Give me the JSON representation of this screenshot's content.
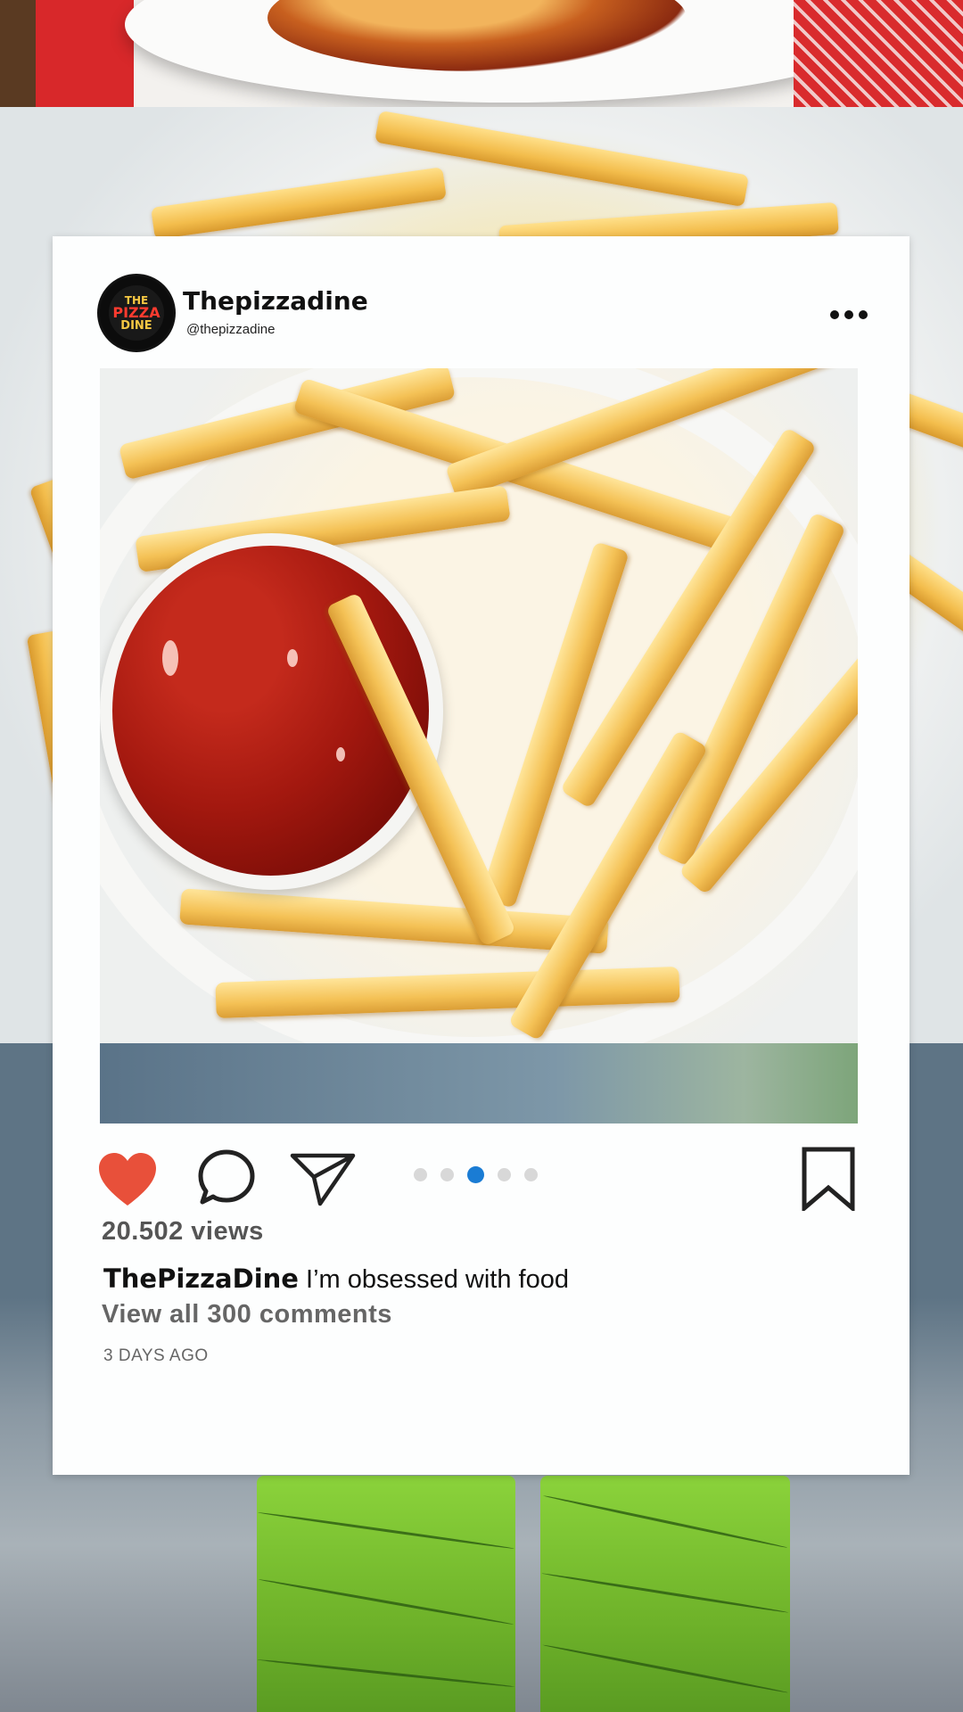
{
  "post": {
    "display_name": "Thepizzadine",
    "handle": "@thepizzadine",
    "avatar_text": {
      "line1": "THE",
      "line2": "PIZZA",
      "line3": "DINE"
    },
    "more_icon": "more-horizontal-icon",
    "carousel": {
      "total": 5,
      "active_index": 2
    },
    "liked": true,
    "views": "20.502 views",
    "caption_user": "ThePizzaDine",
    "caption_text": " I’m obsessed with food",
    "view_comments": "View all 300 comments",
    "time_ago": "3 DAYS AGO"
  },
  "icons": {
    "like": "heart-icon",
    "comment": "comment-icon",
    "share": "send-icon",
    "save": "bookmark-icon"
  },
  "colors": {
    "like": "#e8503a",
    "active_dot": "#1a7cd4",
    "inactive_dot": "#d8d8d8",
    "card": "#fdfefe"
  }
}
